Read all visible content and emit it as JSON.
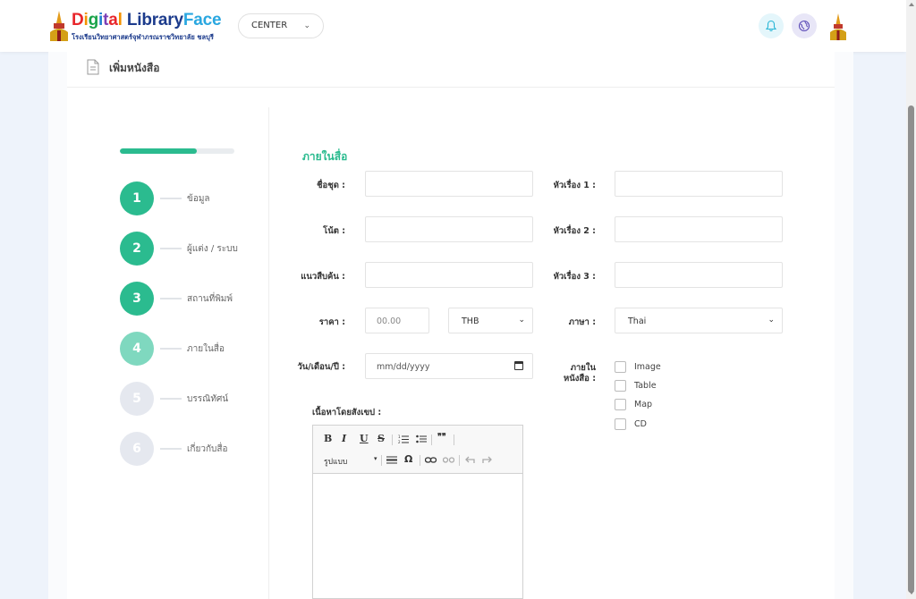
{
  "header": {
    "logo_parts": [
      "D",
      "i",
      "g",
      "i",
      "t",
      "a",
      "l"
    ],
    "logo_rest": " LibraryFace",
    "logo_library": "Library",
    "logo_face": "Face",
    "logo_subtitle": "โรงเรียนวิทยาศาสตร์จุฬาภรณราชวิทยาลัย ชลบุรี",
    "center_select": "CENTER"
  },
  "page": {
    "title": "เพิ่มหนังสือ"
  },
  "stepper": {
    "progress_fraction": 0.67,
    "steps": [
      {
        "number": "1",
        "label": "ข้อมูล",
        "state": "done"
      },
      {
        "number": "2",
        "label": "ผู้แต่ง / ระบบ",
        "state": "done"
      },
      {
        "number": "3",
        "label": "สถานที่พิมพ์",
        "state": "done"
      },
      {
        "number": "4",
        "label": "ภายในสื่อ",
        "state": "active"
      },
      {
        "number": "5",
        "label": "บรรณิทัศน์",
        "state": "todo"
      },
      {
        "number": "6",
        "label": "เกี่ยวกับสื่อ",
        "state": "todo"
      }
    ]
  },
  "form": {
    "section_title": "ภายในสื่อ",
    "series_label": "ชื่อชุด :",
    "note_label": "โน้ต :",
    "guide_label": "แนวสืบค้น :",
    "price_label": "ราคา :",
    "price_placeholder": "00.00",
    "currency_value": "THB",
    "date_label": "วัน/เดือน/ปี :",
    "date_placeholder": "mm/dd/yyyy",
    "subject1_label": "หัวเรื่อง 1 :",
    "subject2_label": "หัวเรื่อง 2 :",
    "subject3_label": "หัวเรื่อง 3 :",
    "language_label": "ภาษา :",
    "language_value": "Thai",
    "inside_label_1": "ภายใน",
    "inside_label_2": "หนังสือ :",
    "checkboxes": [
      {
        "label": "Image",
        "checked": false
      },
      {
        "label": "Table",
        "checked": false
      },
      {
        "label": "Map",
        "checked": false
      },
      {
        "label": "CD",
        "checked": false
      }
    ],
    "summary_label": "เนื้อหาโดยสังเขป :"
  },
  "editor": {
    "bold": "B",
    "italic": "I",
    "underline": "U",
    "strike": "S",
    "quote": "❞❞",
    "omega": "Ω",
    "format_combo": "รูปแบบ"
  },
  "colors": {
    "accent": "#2bbb8f",
    "accent_light": "#7fd8bf",
    "todo": "#e5e8ef"
  }
}
